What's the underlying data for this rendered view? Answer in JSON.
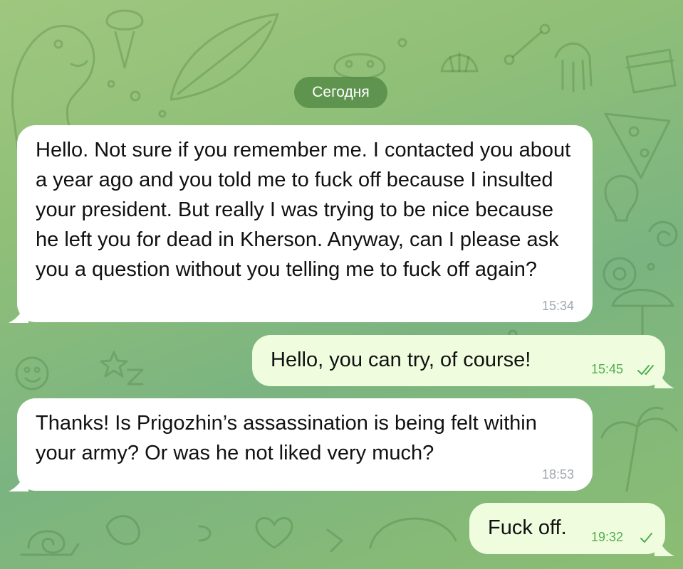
{
  "date_label": "Сегодня",
  "colors": {
    "background_green": "#8fbf78",
    "incoming_bubble": "#ffffff",
    "outgoing_bubble": "#effdde",
    "outgoing_time": "#4fae4e",
    "incoming_time": "#a1a8ae",
    "date_pill": "#568c48"
  },
  "messages": [
    {
      "direction": "incoming",
      "text": "Hello. Not sure if you remember me. I contacted you about a year ago and you told me to fuck off because I insulted your president. But really I was trying to be nice because he left you for dead in Kherson. Anyway, can I please ask you a question without you telling me to fuck off again?",
      "time": "15:34"
    },
    {
      "direction": "outgoing",
      "text": "Hello, you can try, of course!",
      "time": "15:45",
      "status_icon": "double-check-icon"
    },
    {
      "direction": "incoming",
      "text": "Thanks! Is Prigozhin’s assassination is being felt within your army? Or was he not liked very much?",
      "time": "18:53"
    },
    {
      "direction": "outgoing",
      "text": "Fuck off.",
      "time": "19:32",
      "status_icon": "single-check-icon"
    }
  ]
}
